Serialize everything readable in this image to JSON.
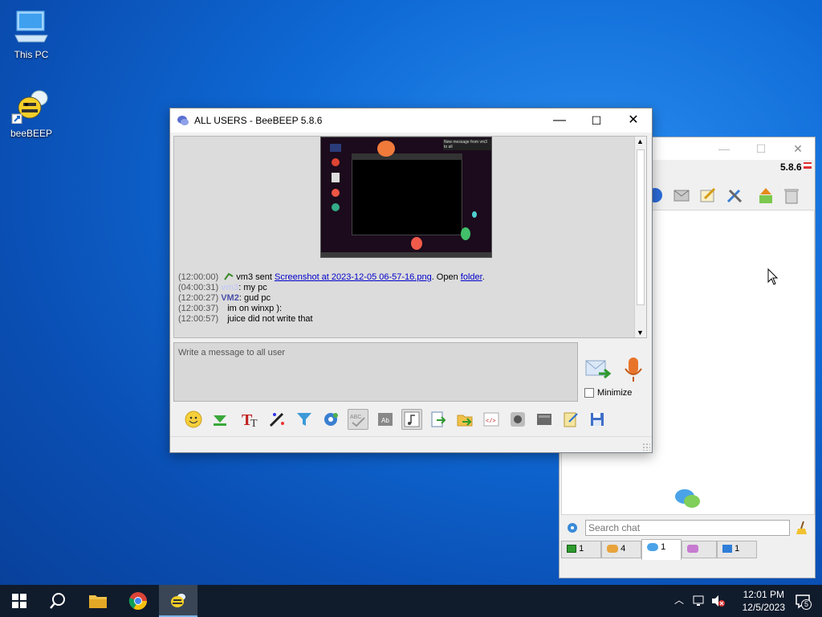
{
  "desktop": {
    "icons": [
      {
        "label": "This PC"
      },
      {
        "label": "beeBEEP"
      }
    ]
  },
  "main_window": {
    "version": "5.8.6",
    "search_placeholder": "Search chat",
    "tabs": [
      "1",
      "4",
      "1",
      "",
      "1"
    ]
  },
  "chat_window": {
    "title": "ALL USERS - BeeBEEP 5.8.6",
    "preview_caption": "New message from vm3 to all",
    "messages": [
      {
        "ts": "(12:00:00)",
        "user": "vm3",
        "text_before": "sent ",
        "link": "Screenshot at 2023-12-05 06-57-16.png",
        "text_after": ". Open ",
        "link2": "folder",
        "end": "."
      },
      {
        "ts": "(04:00:31)",
        "nick": "vm3",
        "text": ": my pc"
      },
      {
        "ts": "(12:00:27)",
        "nick": "VM2",
        "text": ": gud pc"
      },
      {
        "ts": "(12:00:37)",
        "text": "im on winxp ):"
      },
      {
        "ts": "(12:00:57)",
        "text": "juice did not write that"
      }
    ],
    "compose_placeholder": "Write a message to all user",
    "minimize_label": "Minimize"
  },
  "taskbar": {
    "time": "12:01 PM",
    "date": "12/5/2023",
    "notification_count": "5"
  },
  "colors": {
    "desktop_blue": "#0f6ad6",
    "taskbar": "#101b2c",
    "nick": "#4b50a8",
    "link": "#0000cc"
  }
}
